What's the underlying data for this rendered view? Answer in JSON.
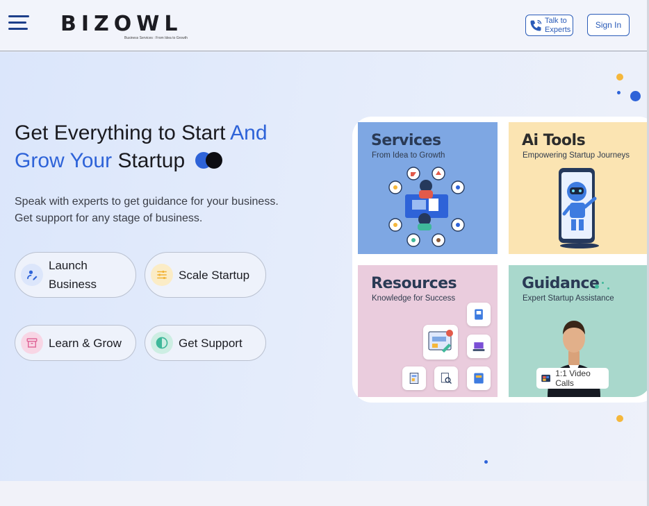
{
  "header": {
    "brand": "BIZOWL",
    "tagline": "Business Services : From Idea to Growth",
    "talk_label": "Talk to Experts",
    "signin_label": "Sign In"
  },
  "hero": {
    "headline_part1": "Get Everything to Start",
    "headline_accent1": "And",
    "headline_accent2": "Grow Your",
    "headline_part2": "Startup",
    "subtext_line1": "Speak with experts to get guidance for your business.",
    "subtext_line2": "Get support for any stage of business.",
    "pills": [
      {
        "label": "Launch Business",
        "icon": "rocket-pen-icon",
        "color": "#2e63d8"
      },
      {
        "label": "Scale Startup",
        "icon": "sliders-icon",
        "color": "#f2b233"
      },
      {
        "label": "Learn & Grow",
        "icon": "archive-box-icon",
        "color": "#e0699a"
      },
      {
        "label": "Get Support",
        "icon": "half-circle-icon",
        "color": "#3fb89a"
      }
    ]
  },
  "cards": [
    {
      "title": "Services",
      "subtitle": "From Idea to Growth",
      "bg": "#7ea7e3"
    },
    {
      "title": "Ai Tools",
      "subtitle": "Empowering Startup Journeys",
      "bg": "#fbe4b2"
    },
    {
      "title": "Resources",
      "subtitle": "Knowledge for Success",
      "bg": "#eaccdd"
    },
    {
      "title": "Guidance",
      "subtitle": "Expert Startup Assistance",
      "bg": "#a9d8cc",
      "badge": "1:1 Video Calls"
    }
  ],
  "colors": {
    "accent": "#2e63d8",
    "dot_yellow": "#f5b73b",
    "dot_blue": "#2e63d8"
  }
}
